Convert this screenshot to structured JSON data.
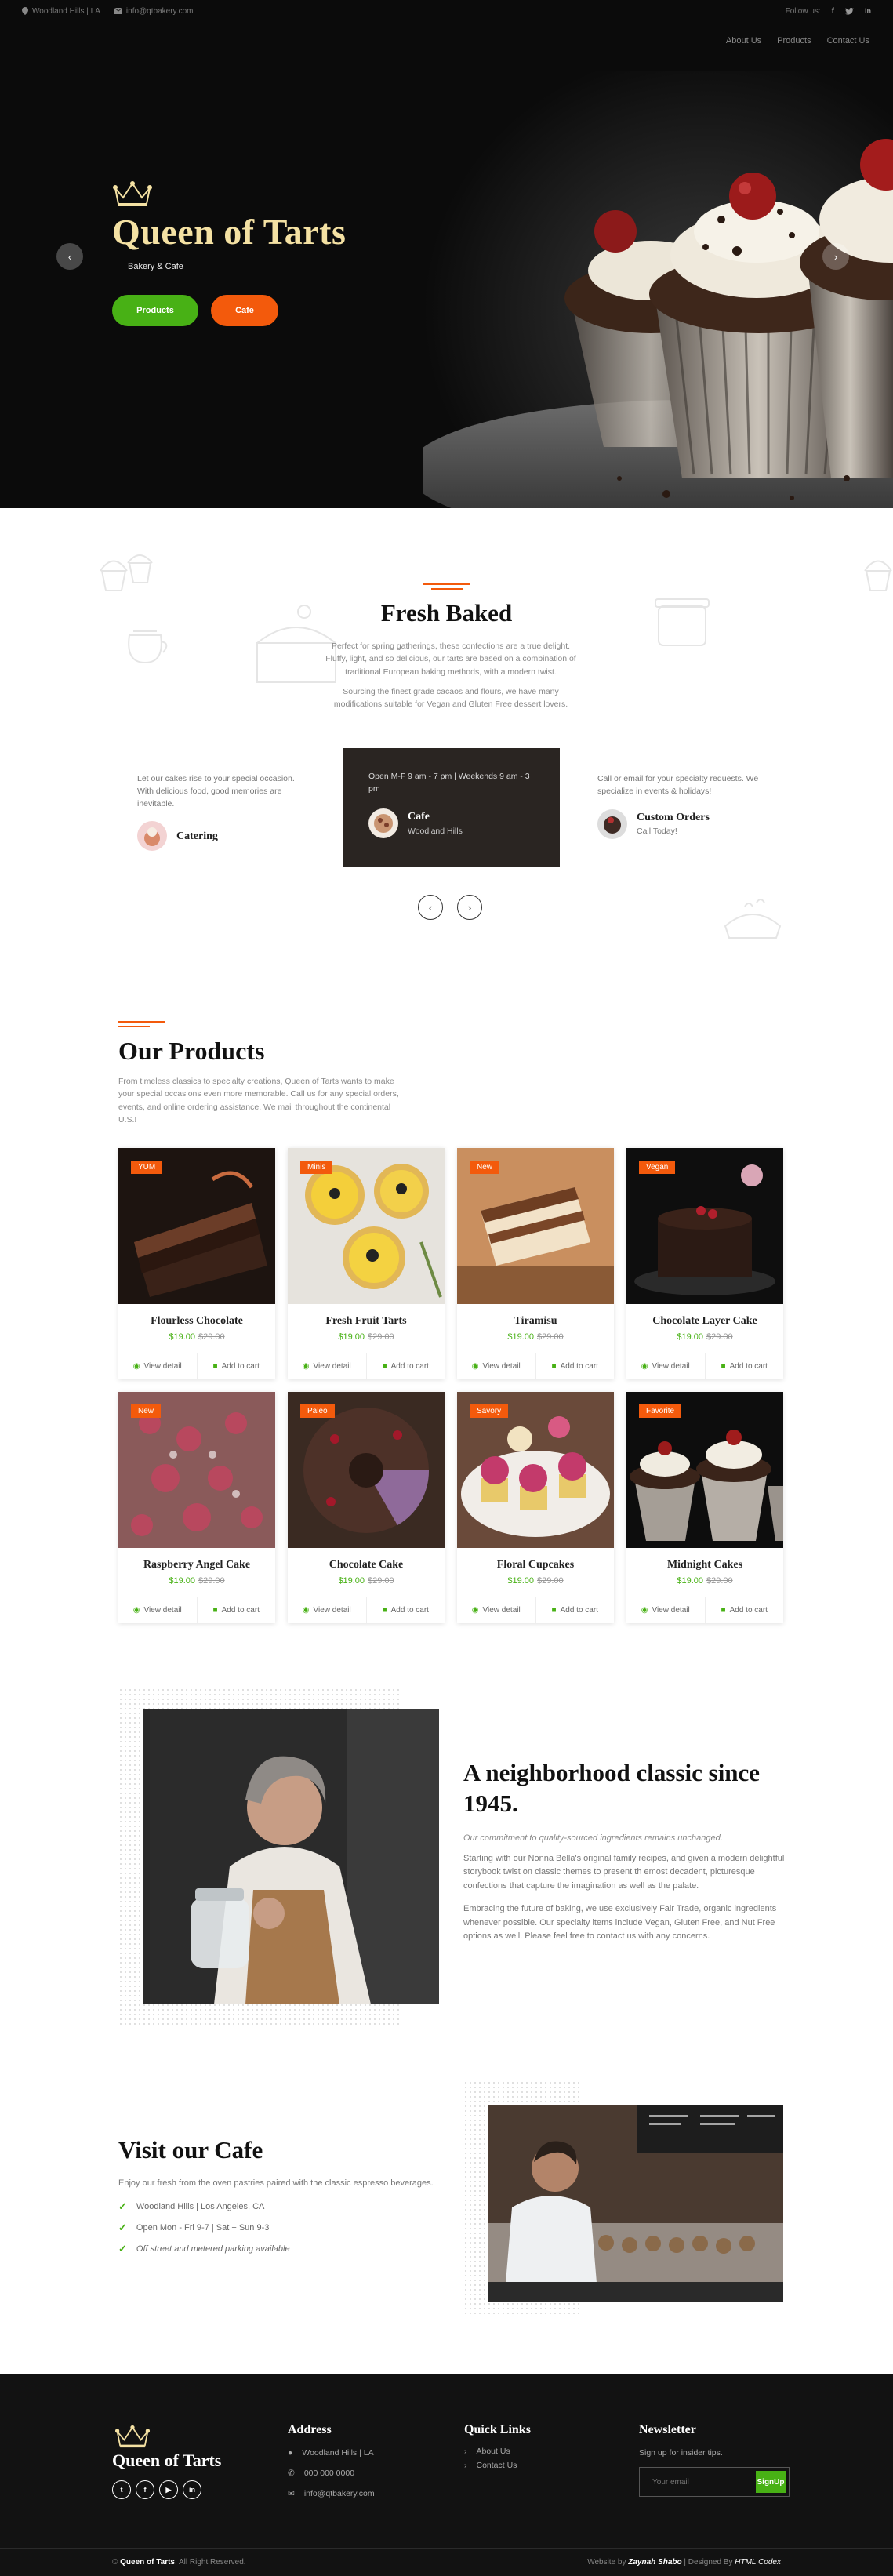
{
  "topbar": {
    "location": "Woodland Hills | LA",
    "email": "info@qtbakery.com",
    "follow_label": "Follow us:"
  },
  "nav": {
    "items": [
      "About Us",
      "Products",
      "Contact Us"
    ]
  },
  "hero": {
    "brand": "Queen of Tarts",
    "subtitle": "Bakery & Cafe",
    "btn_products": "Products",
    "btn_cafe": "Cafe"
  },
  "fresh": {
    "title": "Fresh Baked",
    "p1": "Perfect for spring gatherings, these confections are a true delight. Fluffy, light, and so delicious, our tarts are based on a combination of traditional European baking methods, with a modern twist.",
    "p2": "Sourcing the finest grade cacaos and flours, we have many modifications suitable for Vegan and Gluten Free dessert lovers.",
    "left_text": "Let our cakes rise to your special occasion. With delicious food, good memories are inevitable.",
    "left_title": "Catering",
    "center_text": "Open M-F 9 am - 7 pm | Weekends 9 am - 3 pm",
    "center_title": "Cafe",
    "center_sub": "Woodland Hills",
    "right_text": "Call or email for your specialty requests. We specialize in events & holidays!",
    "right_title": "Custom Orders",
    "right_sub": "Call Today!"
  },
  "products": {
    "title": "Our Products",
    "intro": "From timeless classics to specialty creations, Queen of Tarts wants to make your special occasions even more memorable. Call us for any special orders, events, and online ordering assistance. We mail throughout the continental U.S.!",
    "view_label": "View detail",
    "cart_label": "Add to cart",
    "items": [
      {
        "badge": "YUM",
        "name": "Flourless Chocolate",
        "price": "$19.00",
        "old": "$29.00"
      },
      {
        "badge": "Minis",
        "name": "Fresh Fruit Tarts",
        "price": "$19.00",
        "old": "$29.00"
      },
      {
        "badge": "New",
        "name": "Tiramisu",
        "price": "$19.00",
        "old": "$29.00"
      },
      {
        "badge": "Vegan",
        "name": "Chocolate Layer Cake",
        "price": "$19.00",
        "old": "$29.00"
      },
      {
        "badge": "New",
        "name": "Raspberry Angel Cake",
        "price": "$19.00",
        "old": "$29.00"
      },
      {
        "badge": "Paleo",
        "name": "Chocolate Cake",
        "price": "$19.00",
        "old": "$29.00"
      },
      {
        "badge": "Savory",
        "name": "Floral Cupcakes",
        "price": "$19.00",
        "old": "$29.00"
      },
      {
        "badge": "Favorite",
        "name": "Midnight Cakes",
        "price": "$19.00",
        "old": "$29.00"
      }
    ]
  },
  "classic": {
    "title": "A neighborhood classic since 1945.",
    "italic": "Our commitment to quality-sourced ingredients remains unchanged.",
    "p1": "Starting with our Nonna Bella's original family recipes, and given a modern delightful storybook twist on classic themes to present th emost decadent, picturesque confections that capture the imagination as well as the palate.",
    "p2": "Embracing the future of baking, we use exclusively Fair Trade, organic ingredients whenever possible. Our specialty items include Vegan, Gluten Free, and Nut Free options as well. Please feel free to contact us with any concerns."
  },
  "cafe": {
    "title": "Visit our Cafe",
    "intro": "Enjoy our fresh from the oven pastries paired with the classic espresso beverages.",
    "items": [
      "Woodland Hills | Los Angeles, CA",
      "Open Mon - Fri 9-7 | Sat + Sun 9-3",
      "Off street and metered parking available"
    ]
  },
  "footer": {
    "brand": "Queen of Tarts",
    "address_title": "Address",
    "address": "Woodland Hills | LA",
    "phone": "000 000 0000",
    "email": "info@qtbakery.com",
    "links_title": "Quick Links",
    "links": [
      "About Us",
      "Contact Us"
    ],
    "news_title": "Newsletter",
    "news_text": "Sign up for insider tips.",
    "news_placeholder": "Your email",
    "news_btn": "SignUp",
    "copy_prefix": "©",
    "copy_brand": "Queen of Tarts",
    "copy_suffix": ". All Right Reserved.",
    "credit_prefix": "Website by",
    "credit_name": "Zaynah Shabo",
    "credit_mid": "| Designed By",
    "credit_designer": "HTML Codex"
  },
  "colors": {
    "accent_green": "#48b115",
    "accent_orange": "#f35a0c",
    "brand_gold": "#f4e1a3"
  }
}
